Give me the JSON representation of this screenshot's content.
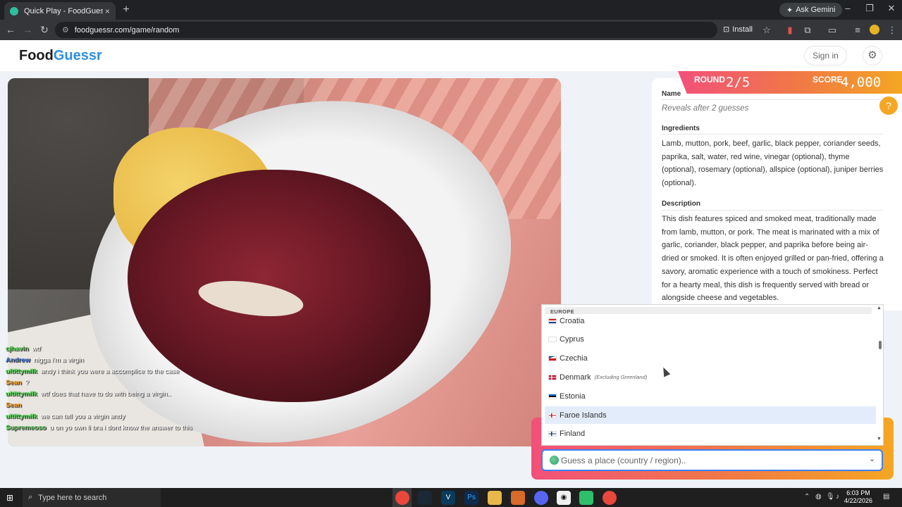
{
  "browser": {
    "tab_title": "Quick Play - FoodGuessr | Food",
    "tab_close": "×",
    "new_tab": "+",
    "ask_gemini": "Ask Gemini",
    "url": "foodguessr.com/game/random",
    "install": "Install"
  },
  "site": {
    "logo_part1": "Food",
    "logo_part2": "Guessr",
    "sign_in": "Sign in",
    "settings_icon": "⚙"
  },
  "game": {
    "round_label": "ROUND",
    "round_value": "2/5",
    "score_label": "SCORE",
    "score_value": "4,000",
    "help_icon": "?"
  },
  "info": {
    "name_title": "Name",
    "name_value": "Reveals after 2 guesses",
    "ingredients_title": "Ingredients",
    "ingredients": "Lamb, mutton, pork, beef, garlic, black pepper, coriander seeds, paprika, salt, water, red wine, vinegar (optional), thyme (optional), rosemary (optional), allspice (optional), juniper berries (optional).",
    "description_title": "Description",
    "description": "This dish features spiced and smoked meat, traditionally made from lamb, mutton, or pork. The meat is marinated with a mix of garlic, coriander, black pepper, and paprika before being air-dried or smoked. It is often enjoyed grilled or pan-fried, offering a savory, aromatic experience with a touch of smokiness. Perfect for a hearty meal, this dish is frequently served with bread or alongside cheese and vegetables."
  },
  "dropdown": {
    "group": "EUROPE",
    "items": [
      {
        "label": "Croatia",
        "note": ""
      },
      {
        "label": "Cyprus",
        "note": ""
      },
      {
        "label": "Czechia",
        "note": ""
      },
      {
        "label": "Denmark",
        "note": "(Excluding Greenland)"
      },
      {
        "label": "Estonia",
        "note": ""
      },
      {
        "label": "Faroe Islands",
        "note": ""
      },
      {
        "label": "Finland",
        "note": ""
      }
    ],
    "highlighted_index": 5,
    "placeholder": "Guess a place (country / region).."
  },
  "chat": [
    {
      "user": "cjhavin",
      "message": "wtf",
      "color": "#57d357"
    },
    {
      "user": "Andrew",
      "message": "nigga i'm a virgin",
      "color": "#3f7be8"
    },
    {
      "user": "ultittymilk",
      "message": "andy i think you were a accomplice to the case",
      "color": "#57d357"
    },
    {
      "user": "Sean",
      "message": "?",
      "color": "#f0a030"
    },
    {
      "user": "ultittymilk",
      "message": "wtf does that have to do with being a virgin..",
      "color": "#57d357"
    },
    {
      "user": "Sean",
      "message": "",
      "color": "#f0a030"
    },
    {
      "user": "ultittymilk",
      "message": "we can tell you a virgin andy",
      "color": "#57d357"
    },
    {
      "user": "Supremeoso",
      "message": "u on yo own li bra i dont know the answer to this",
      "color": "#57d357"
    }
  ],
  "taskbar": {
    "search_placeholder": "Type here to search",
    "time": "6:03 PM",
    "date": "4/22/2026"
  },
  "colors": {
    "accent_blue": "#2d8fe0",
    "banner_start": "#f2507a",
    "banner_end": "#f5a623",
    "highlight_row": "#e3ecfa"
  }
}
